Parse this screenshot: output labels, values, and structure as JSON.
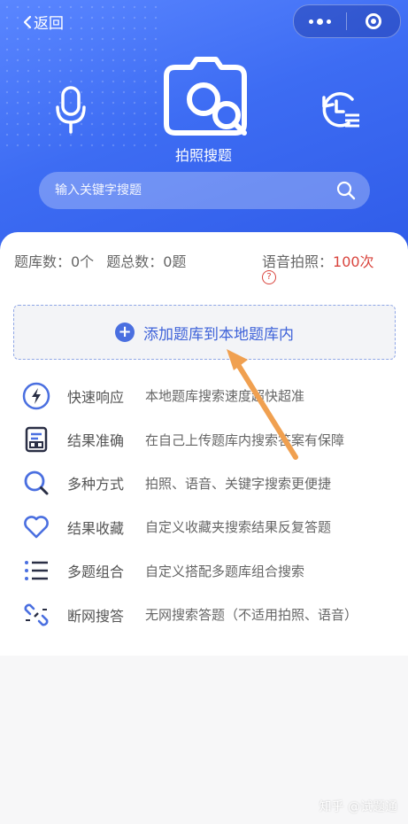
{
  "nav": {
    "back_label": "返回"
  },
  "header": {
    "camera_label": "拍照搜题"
  },
  "search": {
    "placeholder": "输入关键字搜题"
  },
  "stats": {
    "bank_count": "题库数：0个",
    "total_questions": "题总数：0题",
    "voice_label": "语音拍照：",
    "voice_count": "100次",
    "help_glyph": "?"
  },
  "add_button": {
    "label": "添加题库到本地题库内"
  },
  "features": [
    {
      "icon": "lightning-icon",
      "name": "快速响应",
      "desc": "本地题库搜索速度超快超准"
    },
    {
      "icon": "document-icon",
      "name": "结果准确",
      "desc": "在自己上传题库内搜索答案有保障"
    },
    {
      "icon": "search-icon",
      "name": "多种方式",
      "desc": "拍照、语音、关键字搜索更便捷"
    },
    {
      "icon": "heart-icon",
      "name": "结果收藏",
      "desc": "自定义收藏夹搜索结果反复答题"
    },
    {
      "icon": "list-icon",
      "name": "多题组合",
      "desc": "自定义搭配多题库组合搜索"
    },
    {
      "icon": "broken-link-icon",
      "name": "断网搜答",
      "desc": "无网搜索答题（不适用拍照、语音）"
    }
  ],
  "watermark": "知乎 @试题通",
  "colors": {
    "primary": "#3d6cf3",
    "accent_red": "#d9453e",
    "annotation_arrow": "#f0a050"
  }
}
